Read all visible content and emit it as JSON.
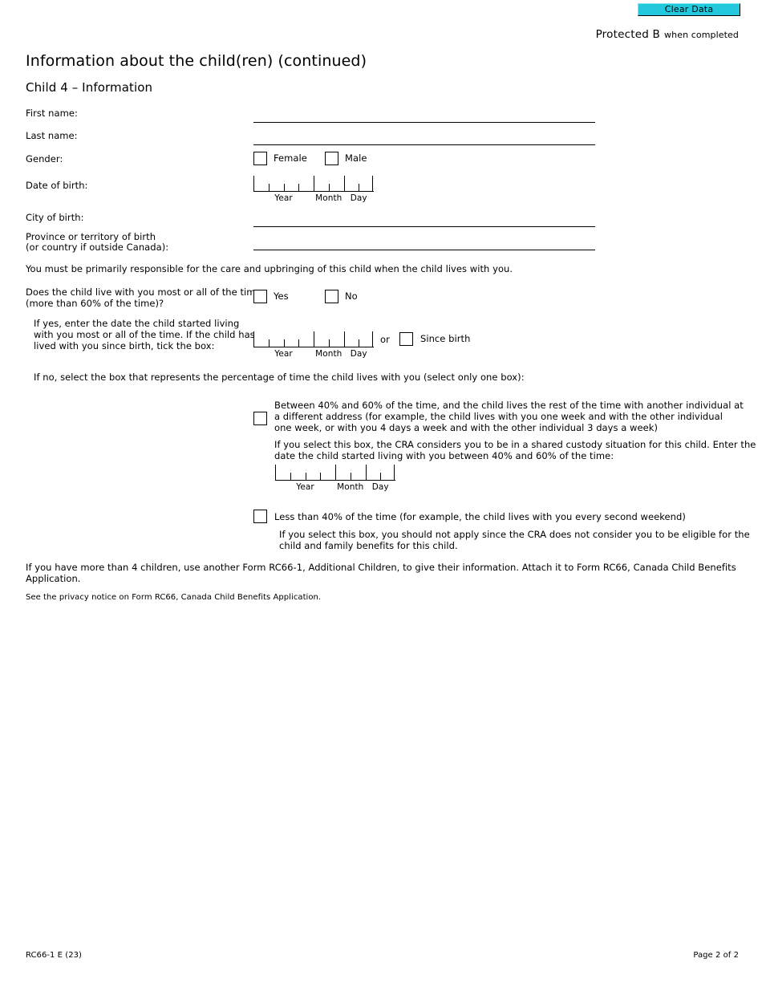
{
  "toolbar": {
    "clear_data_label": "Clear Data",
    "clear_data_bg": "#23c8dd"
  },
  "classification": {
    "main": "Protected B",
    "sub": "when completed"
  },
  "header": {
    "page_title": "Information about the child(ren) (continued)",
    "section_title": "Child 4 – Information"
  },
  "fields": {
    "first_name_label": "First name:",
    "last_name_label": "Last name:",
    "gender_label": "Gender:",
    "gender_female_label": "Female",
    "gender_male_label": "Male",
    "dob_label": "Date of birth:",
    "city_of_birth_label": "City of birth:",
    "province_label_line1": "Province or territory of birth",
    "province_label_line2": "(or country if outside Canada):"
  },
  "date_parts": {
    "year": "Year",
    "month": "Month",
    "day": "Day"
  },
  "responsibility": {
    "statement": "You must be primarily responsible for the care and upbringing of this child when the child lives with you."
  },
  "lives_with_you": {
    "question_line1": "Does the child live with you most or all of the time",
    "question_line2": "(more than 60% of the time)?",
    "yes_label": "Yes",
    "no_label": "No",
    "if_yes_line1": "If yes, enter the date the child started living",
    "if_yes_line2": "with you most or all of the time. If the child has",
    "if_yes_line3": "lived with you since birth, tick the box:",
    "or_label": "or",
    "since_birth_label": "Since birth"
  },
  "if_no": {
    "intro": "If no, select the box that represents the percentage of time the child lives with you (select only one box):",
    "option_shared": {
      "line1": "Between 40% and 60% of the time, and the child lives the rest of the time with another individual at",
      "line2": "a different address (for example, the child lives with you one week and with the other individual",
      "line3": "one week, or with you 4 days a week and with the other individual 3 days a week)",
      "note_line1": "If you select this box, the CRA considers you to be in a shared custody situation for this child. Enter the",
      "note_line2": "date the child started living with you between 40% and 60% of the time:"
    },
    "option_less": {
      "line1": "Less than 40% of the time (for example, the child lives with you every second weekend)",
      "note_line1": "If you select this box, you should not apply since the CRA does not consider you to be eligible for the",
      "note_line2": "child and family benefits for this child."
    }
  },
  "closing": {
    "more_children_line1": "If you have more than 4 children, use another Form RC66-1, Additional Children, to give their information. Attach it to Form RC66, Canada Child Benefits",
    "more_children_line2": "Application.",
    "privacy_notice": "See the privacy notice on Form RC66, Canada Child Benefits Application."
  },
  "footer": {
    "form_code": "RC66-1 E (23)",
    "page_number": "Page 2 of 2"
  }
}
